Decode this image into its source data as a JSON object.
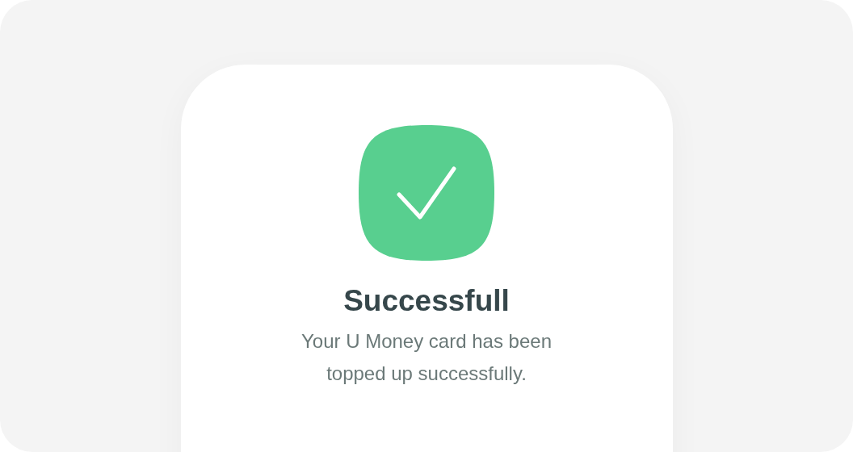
{
  "dialog": {
    "title": "Successfull",
    "message": "Your U Money card has been topped up successfully."
  }
}
